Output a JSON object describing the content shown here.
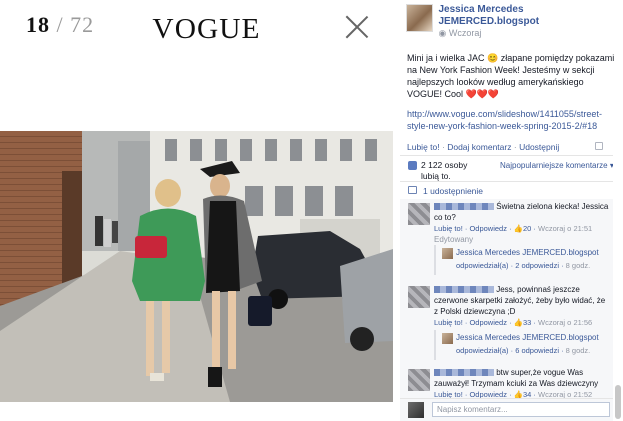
{
  "viewer": {
    "current": "18",
    "separator": "/",
    "total": "72",
    "logo": "VOGUE"
  },
  "post": {
    "author": "Jessica Mercedes JEMERCED.blogspot",
    "time": "Wczoraj",
    "text": "Mini ja i wielka JAC 😊 złapane pomiędzy pokazami na New York Fashion Week! Jesteśmy w sekcji najlepszych looków według amerykańskiego VOGUE! Cool ❤️❤️❤️",
    "link": "http://www.vogue.com/slideshow/1411055/street-style-new-york-fashion-week-spring-2015-2/#18",
    "actions": {
      "like": "Lubię to!",
      "comment": "Dodaj komentarz",
      "share": "Udostępnij",
      "dot": "·"
    }
  },
  "likes": {
    "text": "2 122 osoby lubią to.",
    "sort": "Najpopularniejsze komentarze ▾"
  },
  "shares": {
    "text": "1 udostępnienie"
  },
  "comments": [
    {
      "text": "Świetna zielona kiecka! Jessica co to?",
      "like": "Lubię to!",
      "reply": "Odpowiedz",
      "count": "20",
      "time": "Wczoraj o 21:51",
      "edited": "Edytowany",
      "reply_author": "Jessica Mercedes JEMERCED.blogspot",
      "reply_label": "odpowiedział(a)",
      "reply_count": "2 odpowiedzi",
      "reply_time": "8 godz."
    },
    {
      "text": "Jess, powinnaś jeszcze czerwone skarpetki założyć, żeby było widać, że z Polski dziewczyna ;D",
      "like": "Lubię to!",
      "reply": "Odpowiedz",
      "count": "33",
      "time": "Wczoraj o 21:56",
      "reply_author": "Jessica Mercedes JEMERCED.blogspot",
      "reply_label": "odpowiedział(a)",
      "reply_count": "6 odpowiedzi",
      "reply_time": "8 godz."
    },
    {
      "text": "btw super,że vogue Was zauważył! Trzymam kciuki za Was dziewczyny",
      "like": "Lubię to!",
      "reply": "Odpowiedz",
      "count": "34",
      "time": "Wczoraj o 21:52"
    }
  ],
  "input": {
    "placeholder": "Napisz komentarz..."
  }
}
